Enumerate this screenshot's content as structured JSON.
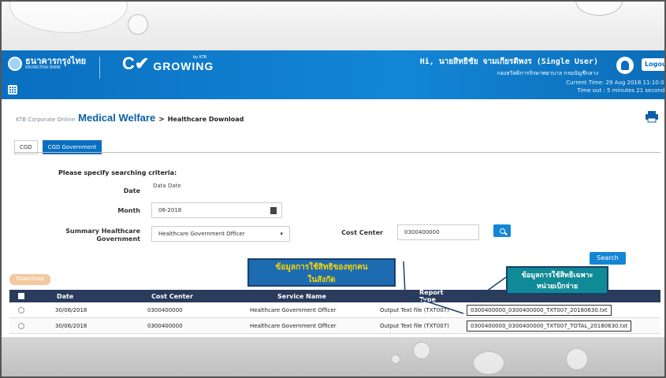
{
  "header": {
    "bank_name": "ธนาคารกรุงไทย",
    "bank_sub": "KRUNGTHAI BANK",
    "product_mark": "C✔",
    "product_name": "GROWING",
    "product_by": "by KTB",
    "greeting": "Hi, นายสิทธิชัย จามเกียรติพงร (Single User)",
    "department": "กองสวัสดิการรักษาพยาบาล กรมบัญชีกลาง",
    "logout_label": "Logout",
    "current_time": "Current Time: 29 Aug 2018 11:10:03",
    "time_out": "Time out : 5 minutes 21 seconds"
  },
  "breadcrumb": {
    "home": "KTB Corporate Online",
    "section": "Medical Welfare",
    "separator": ">",
    "page": "Healthcare Download"
  },
  "tabs": [
    {
      "label": "CGD",
      "active": false
    },
    {
      "label": "CGD Government",
      "active": true
    }
  ],
  "form": {
    "criteria_title": "Please specify searching criteria:",
    "date_label": "Date",
    "date_value": "Data Date",
    "month_label": "Month",
    "month_value": "06-2018",
    "summary_label_1": "Summary Healthcare",
    "summary_label_2": "Government",
    "summary_value": "Healthcare Government Officer",
    "cost_center_label": "Cost Center",
    "cost_center_value": "0300400000",
    "search_label": "Search"
  },
  "download_label": "Download",
  "table": {
    "columns": [
      "Date",
      "Cost Center",
      "Service Name",
      "Report Type"
    ],
    "rows": [
      {
        "date": "30/06/2018",
        "cost_center": "0300400000",
        "service": "Healthcare Government Officer",
        "report_type": "Output Text file (TXT007)",
        "file": "0300400000_0300400000_TXT007_20180630.txt"
      },
      {
        "date": "30/06/2018",
        "cost_center": "0300400000",
        "service": "Healthcare Government Officer",
        "report_type": "Output Text file (TXT007)",
        "file": "0300400000_0300400000_TXT007_TOTAL_20180630.txt"
      }
    ]
  },
  "annotations": {
    "note1_line1": "ข้อมูลการใช้สิทธิของทุกคน",
    "note1_line2": "ในสังกัด",
    "note2_line1": "ข้อมูลการใช้สิทธิเฉพาะ",
    "note2_line2": "หน่วยเบิกจ่าย"
  },
  "colors": {
    "header_blue": "#0a6fc0",
    "accent_blue": "#1386d6",
    "table_header": "#2a3b5c",
    "note_text_yellow": "#f6d400",
    "note2_teal": "#0f8a96"
  }
}
